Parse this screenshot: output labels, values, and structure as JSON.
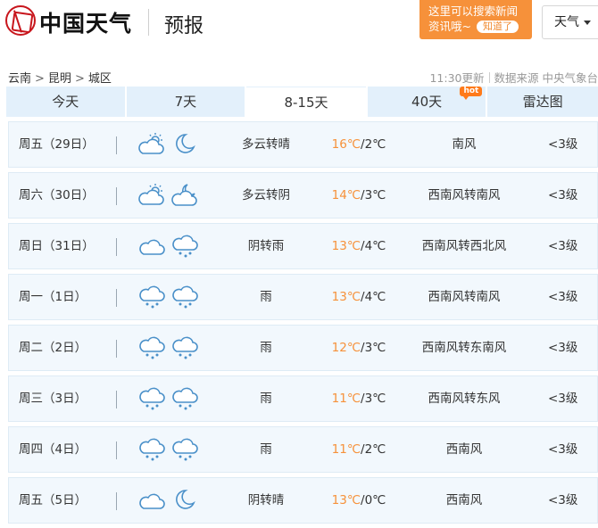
{
  "header": {
    "site_name": "中国天气",
    "section": "预报",
    "promo_line1": "这里可以搜索新闻",
    "promo_line2": "资讯哦~",
    "promo_button": "知道了",
    "search_select": "天气"
  },
  "breadcrumb": [
    "云南",
    "昆明",
    "城区"
  ],
  "update_time": "11:30更新",
  "data_source": "数据来源 中央气象台",
  "tabs": [
    {
      "label": "今天",
      "active": false
    },
    {
      "label": "7天",
      "active": false
    },
    {
      "label": "8-15天",
      "active": true
    },
    {
      "label": "40天",
      "active": false,
      "badge": "hot"
    },
    {
      "label": "雷达图",
      "active": false
    }
  ],
  "colors": {
    "tab_bg": "#e3f0fb",
    "row_bg": "#f2f8fd",
    "high_temp": "#f6913a",
    "icon": "#4a90c9",
    "promo": "#f6913a"
  },
  "forecast": [
    {
      "day": "周五（29日）",
      "icons": [
        "partly-cloudy-day-icon",
        "moon-icon"
      ],
      "condition": "多云转晴",
      "high": "16℃",
      "low": "/2℃",
      "wind": "南风",
      "level": "<3级"
    },
    {
      "day": "周六（30日）",
      "icons": [
        "partly-cloudy-day-icon",
        "cloudy-night-icon"
      ],
      "condition": "多云转阴",
      "high": "14℃",
      "low": "/3℃",
      "wind": "西南风转南风",
      "level": "<3级"
    },
    {
      "day": "周日（31日）",
      "icons": [
        "cloud-icon",
        "rain-cloud-icon"
      ],
      "condition": "阴转雨",
      "high": "13℃",
      "low": "/4℃",
      "wind": "西南风转西北风",
      "level": "<3级"
    },
    {
      "day": "周一（1日）",
      "icons": [
        "rain-cloud-icon",
        "rain-cloud-icon"
      ],
      "condition": "雨",
      "high": "13℃",
      "low": "/4℃",
      "wind": "西南风转南风",
      "level": "<3级"
    },
    {
      "day": "周二（2日）",
      "icons": [
        "rain-cloud-icon",
        "rain-cloud-icon"
      ],
      "condition": "雨",
      "high": "12℃",
      "low": "/3℃",
      "wind": "西南风转东南风",
      "level": "<3级"
    },
    {
      "day": "周三（3日）",
      "icons": [
        "rain-cloud-icon",
        "rain-cloud-icon"
      ],
      "condition": "雨",
      "high": "11℃",
      "low": "/3℃",
      "wind": "西南风转东风",
      "level": "<3级"
    },
    {
      "day": "周四（4日）",
      "icons": [
        "rain-cloud-icon",
        "rain-cloud-icon"
      ],
      "condition": "雨",
      "high": "11℃",
      "low": "/2℃",
      "wind": "西南风",
      "level": "<3级"
    },
    {
      "day": "周五（5日）",
      "icons": [
        "cloud-icon",
        "moon-icon"
      ],
      "condition": "阴转晴",
      "high": "13℃",
      "low": "/0℃",
      "wind": "西南风",
      "level": "<3级"
    }
  ]
}
